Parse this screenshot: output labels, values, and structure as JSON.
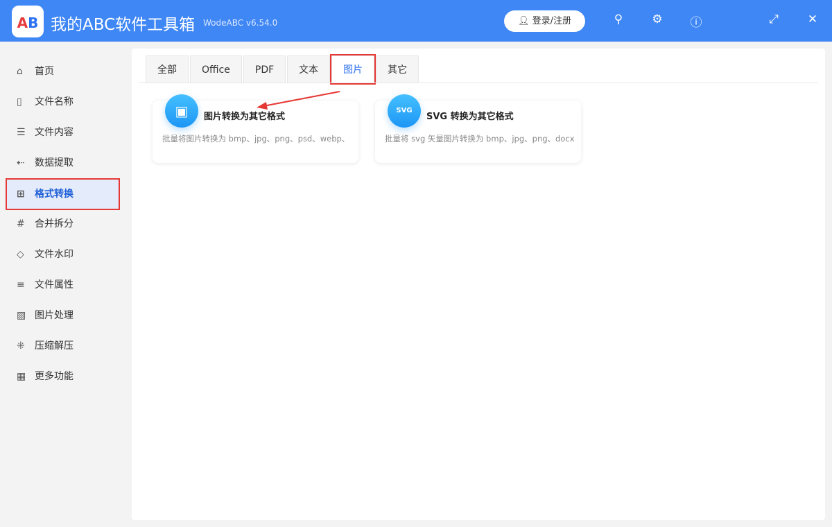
{
  "app": {
    "title": "我的ABC软件工具箱",
    "version": "WodeABC v6.54.0",
    "logo_text": "AB",
    "login": "登录/注册"
  },
  "sidebar": {
    "items": [
      {
        "label": "首页",
        "icon": "⌂"
      },
      {
        "label": "文件名称",
        "icon": "▯"
      },
      {
        "label": "文件内容",
        "icon": "☰"
      },
      {
        "label": "数据提取",
        "icon": "⇠"
      },
      {
        "label": "格式转换",
        "icon": "⊞"
      },
      {
        "label": "合并拆分",
        "icon": "#"
      },
      {
        "label": "文件水印",
        "icon": "◇"
      },
      {
        "label": "文件属性",
        "icon": "≡"
      },
      {
        "label": "图片处理",
        "icon": "▨"
      },
      {
        "label": "压缩解压",
        "icon": "⁜"
      },
      {
        "label": "更多功能",
        "icon": "▦"
      }
    ]
  },
  "tabs": [
    "全部",
    "Office",
    "PDF",
    "文本",
    "图片",
    "其它"
  ],
  "cards": [
    {
      "title": "图片转换为其它格式",
      "desc": "批量将图片转换为 bmp、jpg、png、psd、webp、",
      "icon": "▣"
    },
    {
      "title": "SVG 转换为其它格式",
      "desc": "批量将 svg 矢量图片转换为 bmp、jpg、png、docx",
      "icon": "SVG"
    }
  ]
}
